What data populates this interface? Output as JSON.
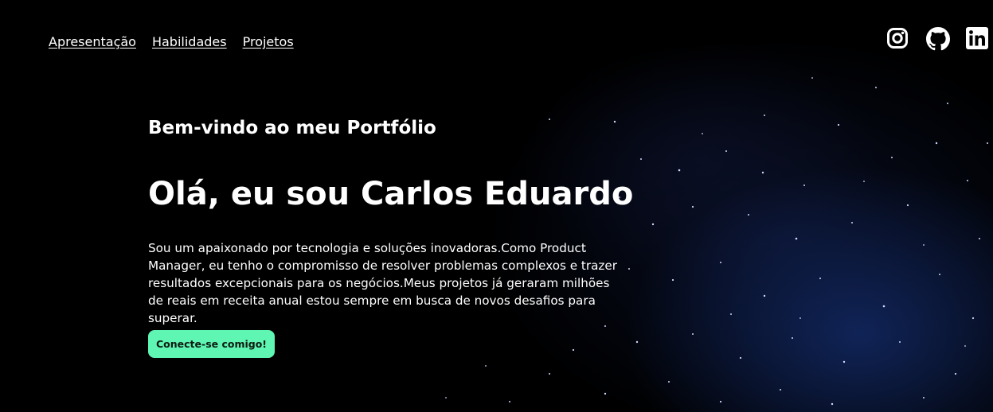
{
  "nav": {
    "items": [
      {
        "label": "Apresentação"
      },
      {
        "label": "Habilidades"
      },
      {
        "label": "Projetos"
      }
    ]
  },
  "socials": [
    {
      "icon": "instagram-icon"
    },
    {
      "icon": "github-icon"
    },
    {
      "icon": "linkedin-icon"
    }
  ],
  "hero": {
    "welcome": "Bem-vindo ao meu Portfólio",
    "headline": "Olá, eu sou Carlos Eduardo",
    "intro": "Sou um apaixonado por tecnologia e soluções inovadoras.Como Product Manager, eu tenho o compromisso de resolver problemas complexos e trazer resultados excepcionais para os negócios.Meus projetos já geraram milhões de reais em receita anual estou sempre em busca de novos desafios para superar.",
    "cta_label": "Conecte-se comigo!"
  },
  "colors": {
    "background": "#000000",
    "accent": "#5ff5b2",
    "text": "#ffffff"
  }
}
